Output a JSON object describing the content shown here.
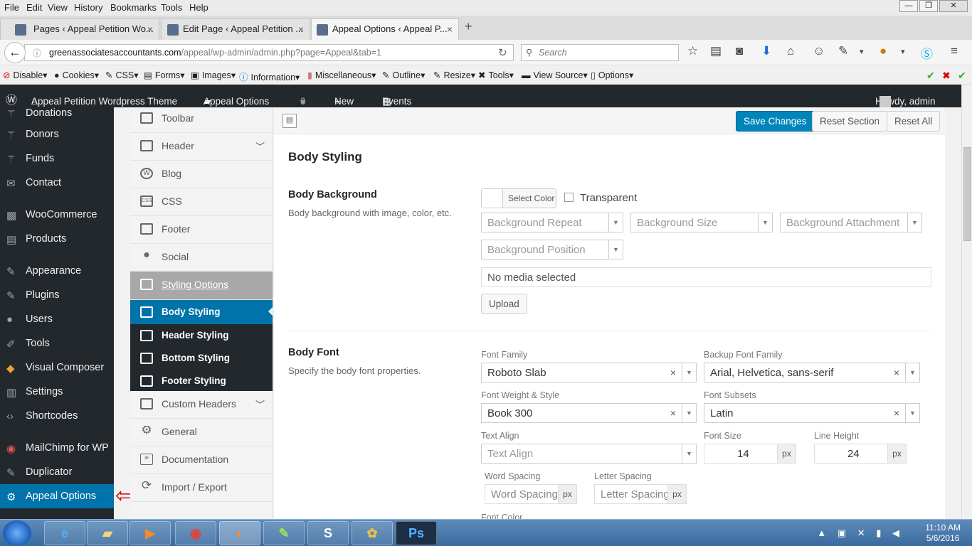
{
  "menubar": [
    "File",
    "Edit",
    "View",
    "History",
    "Bookmarks",
    "Tools",
    "Help"
  ],
  "window_controls": {
    "minimize": "—",
    "maximize": "❐",
    "close": "✕"
  },
  "tabs": [
    {
      "label": "Pages ‹ Appeal Petition Wo...",
      "close": "×"
    },
    {
      "label": "Edit Page ‹ Appeal Petition ...",
      "close": "×"
    },
    {
      "label": "Appeal Options ‹ Appeal P...",
      "close": "×"
    }
  ],
  "new_tab": "+",
  "nav": {
    "back": "←",
    "url_domain": "greenassociatesaccountants.com",
    "url_rest": "/appeal/wp-admin/admin.php?page=Appeal&tab=1",
    "search_placeholder": "Search",
    "reload": "↻"
  },
  "webdev_toolbar": [
    "Disable",
    "Cookies",
    "CSS",
    "Forms",
    "Images",
    "Information",
    "Miscellaneous",
    "Outline",
    "Resize",
    "Tools",
    "View Source",
    "Options"
  ],
  "adminbar": {
    "site": "Appeal Petition Wordpress Theme",
    "options": "Appeal Options",
    "comments": "0",
    "new": "New",
    "events": "Events",
    "howdy": "Howdy, admin"
  },
  "wp_menu": [
    {
      "label": "Donations",
      "icon": "donations-icon"
    },
    {
      "label": "Donors",
      "icon": "donors-icon"
    },
    {
      "label": "Funds",
      "icon": "funds-icon"
    },
    {
      "label": "Contact",
      "icon": "mail-icon"
    },
    {
      "label": "WooCommerce",
      "icon": "woocommerce-icon"
    },
    {
      "label": "Products",
      "icon": "products-icon"
    },
    {
      "label": "Appearance",
      "icon": "brush-icon"
    },
    {
      "label": "Plugins",
      "icon": "plugin-icon"
    },
    {
      "label": "Users",
      "icon": "users-icon"
    },
    {
      "label": "Tools",
      "icon": "wrench-icon"
    },
    {
      "label": "Visual Composer",
      "icon": "visual-composer-icon"
    },
    {
      "label": "Settings",
      "icon": "settings-icon"
    },
    {
      "label": "Shortcodes",
      "icon": "code-icon"
    },
    {
      "label": "MailChimp for WP",
      "icon": "mailchimp-icon"
    },
    {
      "label": "Duplicator",
      "icon": "duplicator-icon"
    },
    {
      "label": "Appeal Options",
      "icon": "gear-icon"
    }
  ],
  "redux_menu": {
    "toolbar": "Toolbar",
    "header": "Header",
    "blog": "Blog",
    "css": "CSS",
    "footer": "Footer",
    "social": "Social",
    "styling": "Styling Options",
    "body_styling": "Body Styling",
    "header_styling": "Header Styling",
    "bottom_styling": "Bottom Styling",
    "footer_styling": "Footer Styling",
    "custom_headers": "Custom Headers",
    "general": "General",
    "documentation": "Documentation",
    "import_export": "Import / Export"
  },
  "buttons": {
    "save": "Save Changes",
    "reset_section": "Reset Section",
    "reset_all": "Reset All",
    "upload": "Upload",
    "select_color": "Select Color"
  },
  "section": {
    "title": "Body Styling"
  },
  "body_background": {
    "title": "Body Background",
    "desc": "Body background with image, color, etc.",
    "transparent": "Transparent",
    "repeat": "Background Repeat",
    "size": "Background Size",
    "attachment": "Background Attachment",
    "position": "Background Position",
    "media": "No media selected"
  },
  "body_font": {
    "title": "Body Font",
    "desc": "Specify the body font properties.",
    "font_family_label": "Font Family",
    "font_family": "Roboto Slab",
    "backup_label": "Backup Font Family",
    "backup": "Arial, Helvetica, sans-serif",
    "weight_label": "Font Weight & Style",
    "weight": "Book 300",
    "subsets_label": "Font Subsets",
    "subsets": "Latin",
    "align_label": "Text Align",
    "align_placeholder": "Text Align",
    "size_label": "Font Size",
    "size": "14",
    "line_label": "Line Height",
    "line": "24",
    "unit": "px",
    "word_label": "Word Spacing",
    "word_placeholder": "Word Spacing",
    "letter_label": "Letter Spacing",
    "letter_placeholder": "Letter Spacing",
    "color_label": "Font Color"
  },
  "clock": {
    "time": "11:10 AM",
    "date": "5/6/2016"
  }
}
